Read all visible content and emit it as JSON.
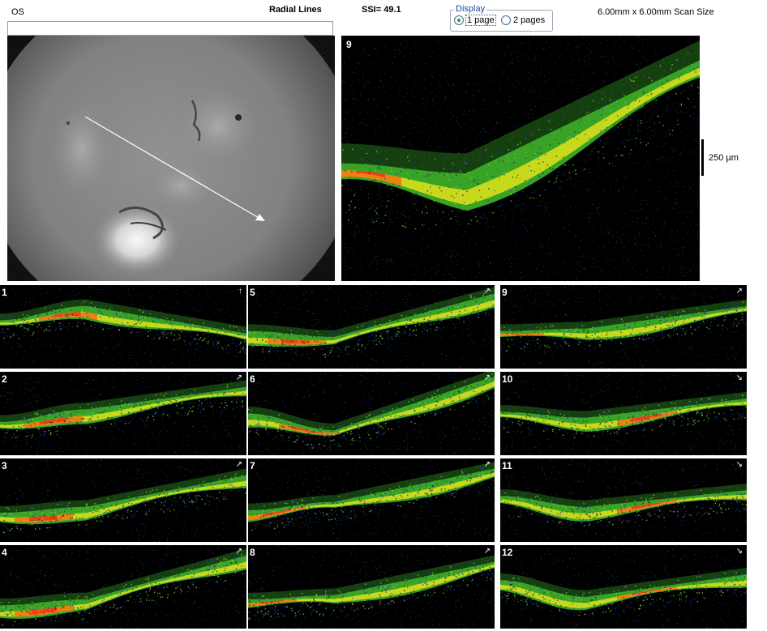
{
  "header": {
    "eye": "OS",
    "scan_mode": "Radial Lines",
    "ssi": "SSI= 49.1",
    "scan_size": "6.00mm x 6.00mm Scan Size"
  },
  "display": {
    "legend": "Display",
    "options": [
      {
        "label": "1 page",
        "selected": true
      },
      {
        "label": "2 pages",
        "selected": false
      }
    ]
  },
  "main_scan": {
    "line_number": "9",
    "scale_label": "250 µm"
  },
  "thumbnails": [
    {
      "label": "1",
      "arrow": "↑"
    },
    {
      "label": "2",
      "arrow": "↗"
    },
    {
      "label": "3",
      "arrow": "↗"
    },
    {
      "label": "4",
      "arrow": "↗"
    },
    {
      "label": "5",
      "arrow": "↗"
    },
    {
      "label": "6",
      "arrow": "↗"
    },
    {
      "label": "7",
      "arrow": "↗"
    },
    {
      "label": "8",
      "arrow": "↗"
    },
    {
      "label": "9",
      "arrow": "↗"
    },
    {
      "label": "10",
      "arrow": "↘"
    },
    {
      "label": "11",
      "arrow": "↘"
    },
    {
      "label": "12",
      "arrow": "↘"
    }
  ],
  "colors": {
    "retina_green": "#3fb52a",
    "retina_yellow": "#e2e21c",
    "retina_orange": "#f07a12",
    "retina_red": "#e8341a",
    "scan_arrow": "#ffffff",
    "radio_accent": "#2e9a2e"
  }
}
